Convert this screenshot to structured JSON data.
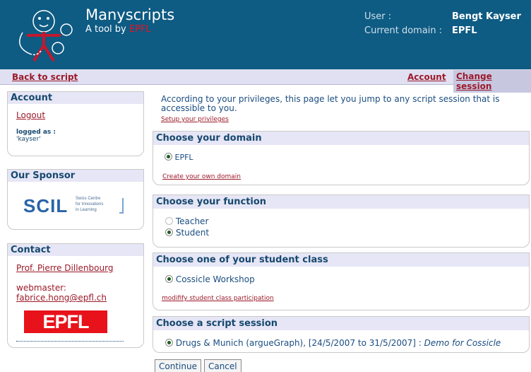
{
  "header": {
    "app_title": "Manyscripts",
    "app_subtitle_prefix": "A tool by",
    "app_subtitle_brand": "EPFL",
    "user_label": "User :",
    "user_value": "Bengt Kayser",
    "domain_label": "Current domain :",
    "domain_value": "EPFL"
  },
  "navbar": {
    "back_label": "Back to script",
    "account_label": "Account",
    "change_session_label": "Change session"
  },
  "sidebar": {
    "account": {
      "title": "Account",
      "logout_label": "Logout",
      "logged_as_label": "logged as :",
      "logged_as_value": "'kayser'"
    },
    "sponsor": {
      "title": "Our Sponsor",
      "logo_text": "SCIL",
      "logo_line1": "Swiss Centre",
      "logo_line2": "for Innovations",
      "logo_line3": "in Learning"
    },
    "contact": {
      "title": "Contact",
      "person_link": "Prof. Pierre Dillenbourg",
      "webmaster_label": "webmaster:",
      "webmaster_email": "fabrice.hong@epfl.ch",
      "logo_text": "EPFL"
    }
  },
  "main": {
    "intro_text": "According to your privileges, this page let you jump to any script session that is accessible to you.",
    "setup_privileges_link": "Setup your privileges",
    "domain_box": {
      "title": "Choose your domain",
      "options": [
        "EPFL"
      ],
      "selected": "EPFL",
      "create_link": "Create your own domain"
    },
    "function_box": {
      "title": "Choose your function",
      "options": [
        "Teacher",
        "Student"
      ],
      "selected": "Student"
    },
    "class_box": {
      "title": "Choose one of your student class",
      "options": [
        "Cossicle Workshop"
      ],
      "selected": "Cossicle Workshop",
      "modify_link": "modifify student class participation"
    },
    "session_box": {
      "title": "Choose a script session",
      "option_text": "Drugs & Munich (argueGraph), [24/5/2007 to 31/5/2007] :",
      "option_note": "Demo for Cossicle"
    },
    "buttons": {
      "continue_label": "Continue",
      "cancel_label": "Cancel"
    }
  },
  "colors": {
    "header_bg": "#0e5b83",
    "link_red": "#9c1a2a",
    "box_head_bg": "#e6e6f6",
    "text_blue": "#1a4d80"
  }
}
